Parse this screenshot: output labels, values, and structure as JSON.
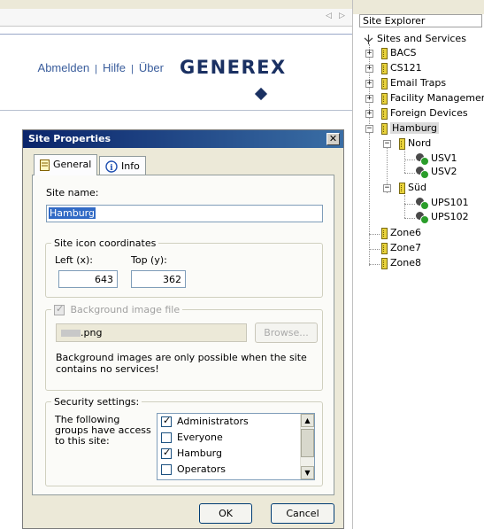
{
  "web": {
    "links": [
      "Abmelden",
      "Hilfe",
      "Über"
    ],
    "link_separator": "|",
    "logo_text": "GENEREX",
    "nav_arrows": [
      "◁",
      "▷"
    ]
  },
  "dialog": {
    "title": "Site Properties",
    "close_glyph": "✕",
    "tabs": [
      {
        "label": "General",
        "icon": "page-icon",
        "active": true
      },
      {
        "label": "Info",
        "icon": "info-icon",
        "active": false
      }
    ],
    "site_name": {
      "label": "Site name:",
      "value": "Hamburg"
    },
    "coords": {
      "group_title": "Site icon coordinates",
      "left_label": "Left (x):",
      "left_value": "643",
      "top_label": "Top (y):",
      "top_value": "362"
    },
    "background": {
      "checkbox_label": "Background image file",
      "checked": true,
      "disabled": true,
      "file_value": ".png",
      "browse_label": "Browse...",
      "note": "Background images are only possible when the site contains no services!"
    },
    "security": {
      "group_title": "Security settings:",
      "description": "The following groups have access to this site:",
      "groups": [
        {
          "label": "Administrators",
          "checked": true
        },
        {
          "label": "Everyone",
          "checked": false
        },
        {
          "label": "Hamburg",
          "checked": true
        },
        {
          "label": "Operators",
          "checked": false
        }
      ]
    },
    "ok_label": "OK",
    "cancel_label": "Cancel"
  },
  "explorer": {
    "title": "Site Explorer",
    "root": "Sites and Services",
    "nodes": [
      {
        "label": "BACS",
        "expander": "+"
      },
      {
        "label": "CS121",
        "expander": "+"
      },
      {
        "label": "Email Traps",
        "expander": "+"
      },
      {
        "label": "Facility Managemer",
        "expander": "+"
      },
      {
        "label": "Foreign Devices",
        "expander": "+"
      },
      {
        "label": "Hamburg",
        "expander": "−",
        "selected": true
      },
      {
        "label": "Nord",
        "expander": "−"
      },
      {
        "label": "USV1",
        "expander": ""
      },
      {
        "label": "USV2",
        "expander": ""
      },
      {
        "label": "Süd",
        "expander": "−"
      },
      {
        "label": "UPS101",
        "expander": ""
      },
      {
        "label": "UPS102",
        "expander": ""
      },
      {
        "label": "Zone6",
        "expander": ""
      },
      {
        "label": "Zone7",
        "expander": ""
      },
      {
        "label": "Zone8",
        "expander": ""
      }
    ],
    "colors": {
      "site_icon": "#e8d23c",
      "ups_icon": "#2a9d2a"
    }
  }
}
